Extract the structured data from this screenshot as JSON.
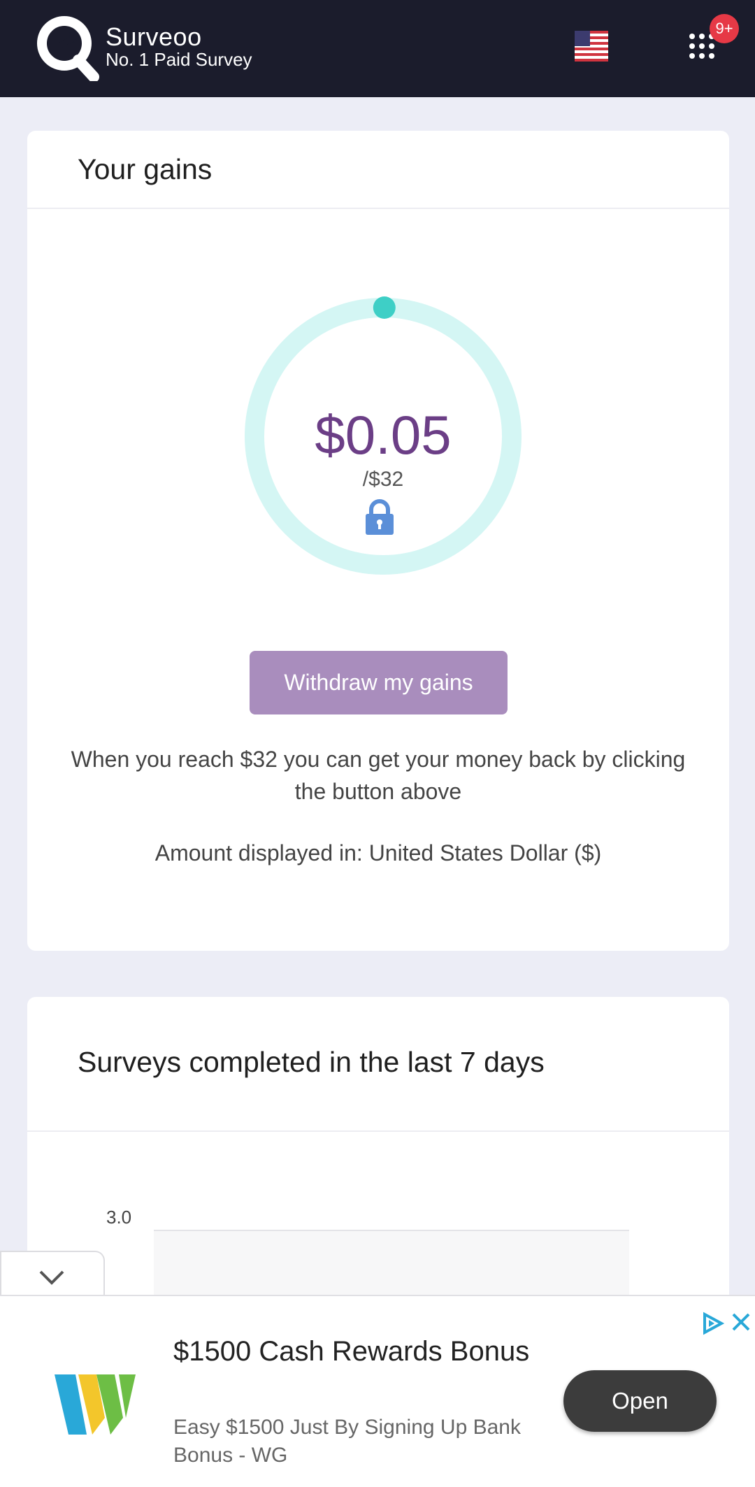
{
  "header": {
    "brand_name": "Surveoo",
    "brand_tagline": "No. 1 Paid Survey",
    "notification_badge": "9+",
    "flag_icon": "us-flag-icon",
    "menu_icon": "apps-grid-icon"
  },
  "gains": {
    "title": "Your gains",
    "amount": "$0.05",
    "target": "/$32",
    "progress_fraction": 0.0016,
    "lock_icon": "lock-icon",
    "withdraw_label": "Withdraw my gains",
    "info_text": "When you reach $32 you can get your money back by clicking the button above",
    "currency_text": "Amount displayed in: United States Dollar ($)"
  },
  "surveys": {
    "title": "Surveys completed in the last 7 days"
  },
  "chart_data": {
    "type": "bar",
    "title": "",
    "y_tick_labels": [
      "3.0"
    ],
    "ylim": [
      0,
      3.0
    ],
    "grid": true
  },
  "ad": {
    "title": "$1500 Cash Rewards Bonus",
    "description": "Easy $1500 Just By Signing Up Bank Bonus - WG",
    "open_label": "Open",
    "collapse_icon": "chevron-down-icon",
    "adchoices_icon": "adchoices-icon",
    "close_icon": "close-icon"
  },
  "colors": {
    "header_bg": "#1B1C2C",
    "accent_purple": "#6B3E86",
    "button_purple": "#A98DBD",
    "gauge_track": "#D4F6F4",
    "gauge_knob": "#3ECFC6",
    "badge_red": "#E63946"
  }
}
